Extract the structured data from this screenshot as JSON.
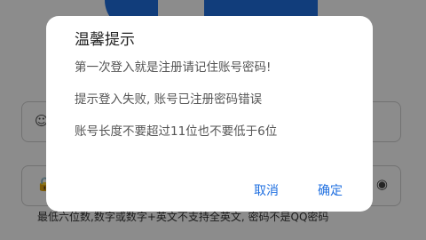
{
  "background": {
    "password_hint": "最低六位数,数字或数字+英文不支持全英文, 密码不是QQ密码",
    "accent_color": "#1f6fe0",
    "icons": [
      "user-icon",
      "lock-icon",
      "eye-icon"
    ]
  },
  "dialog": {
    "title": "温馨提示",
    "messages": [
      "第一次登入就是注册请记住账号密码!",
      "提示登入失败, 账号已注册密码错误",
      "账号长度不要超过11位也不要低于6位"
    ],
    "cancel_label": "取消",
    "confirm_label": "确定"
  }
}
